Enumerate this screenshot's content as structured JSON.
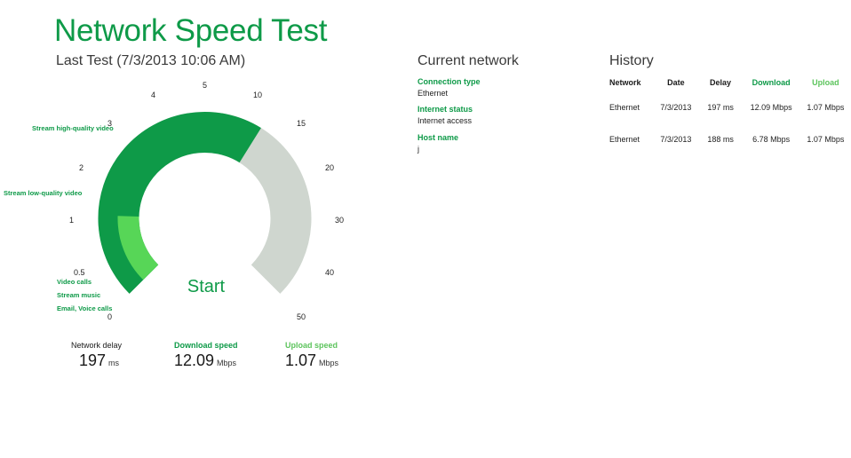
{
  "app": {
    "title": "Network Speed Test",
    "last_test": "Last Test (7/3/2013 10:06 AM)"
  },
  "gauge": {
    "ticks": [
      "0",
      "0.5",
      "1",
      "2",
      "3",
      "4",
      "5",
      "10",
      "15",
      "20",
      "30",
      "40",
      "50"
    ],
    "markers": [
      "Email, Voice calls",
      "Stream music",
      "Video calls",
      "Stream low-quality video",
      "Stream high-quality video"
    ],
    "download_mbps": 12.09,
    "upload_mbps": 1.07,
    "start_label": "Start",
    "colors": {
      "track": "#cfd6cf",
      "download": "#0e9a48",
      "upload": "#57d657"
    }
  },
  "stats": {
    "delay": {
      "label": "Network delay",
      "value": "197",
      "unit": "ms"
    },
    "download": {
      "label": "Download speed",
      "value": "12.09",
      "unit": "Mbps"
    },
    "upload": {
      "label": "Upload speed",
      "value": "1.07",
      "unit": "Mbps"
    }
  },
  "current_network": {
    "heading": "Current network",
    "connection_type_label": "Connection type",
    "connection_type_value": "Ethernet",
    "internet_status_label": "Internet status",
    "internet_status_value": "Internet access",
    "host_name_label": "Host name",
    "host_name_value": "j"
  },
  "history": {
    "heading": "History",
    "columns": [
      "Network",
      "Date",
      "Delay",
      "Download",
      "Upload"
    ],
    "rows": [
      [
        "Ethernet",
        "7/3/2013",
        "197 ms",
        "12.09 Mbps",
        "1.07 Mbps"
      ],
      [
        "Ethernet",
        "7/3/2013",
        "188 ms",
        "6.78 Mbps",
        "1.07 Mbps"
      ]
    ]
  }
}
